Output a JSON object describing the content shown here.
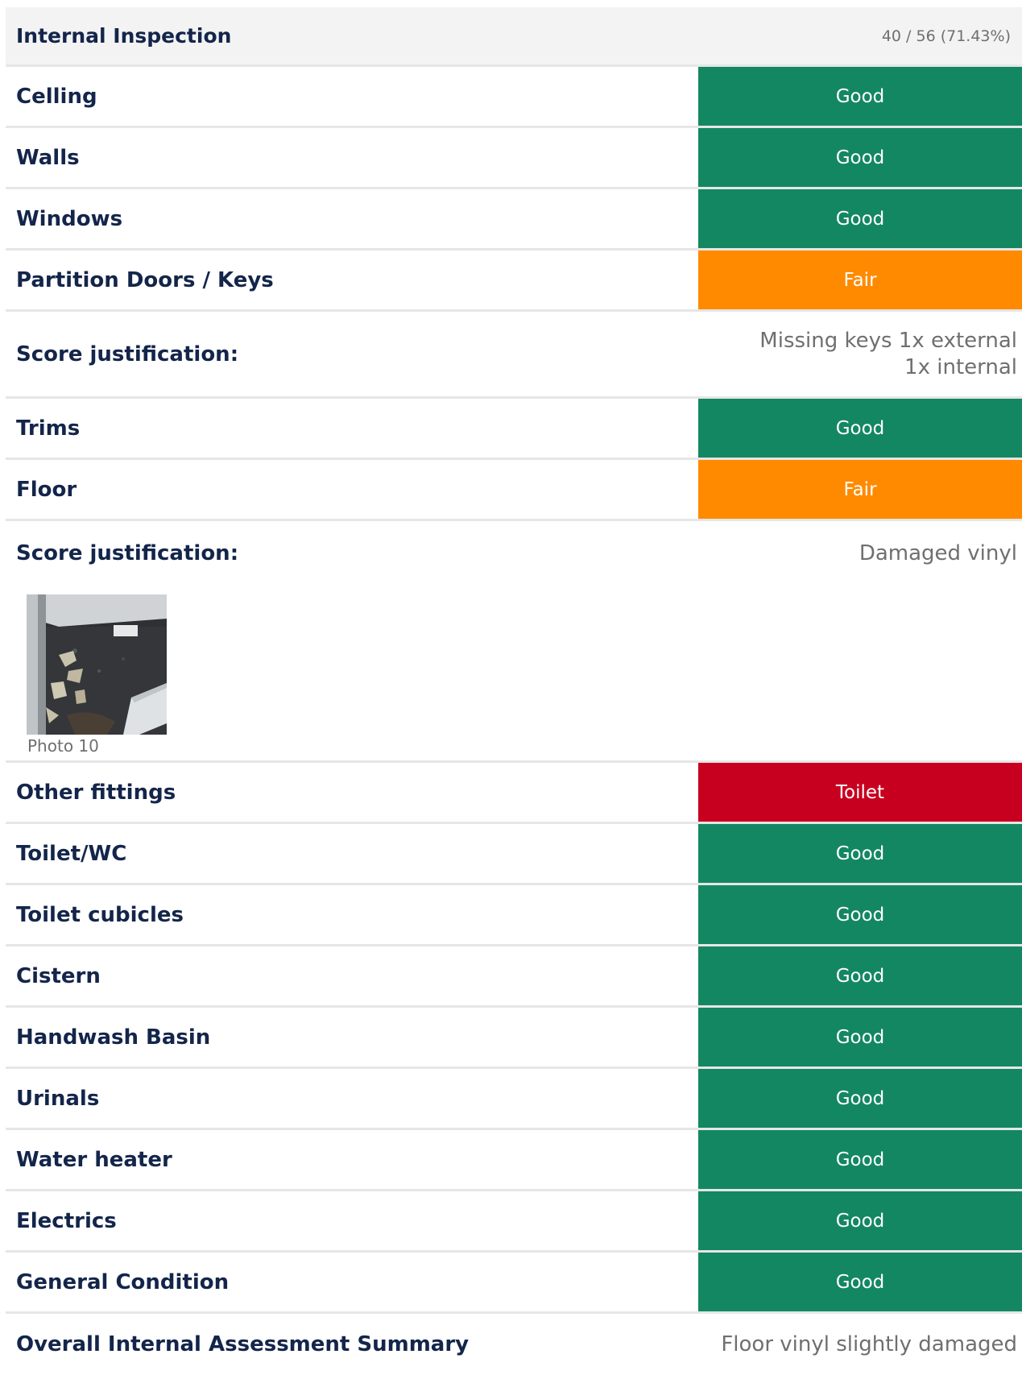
{
  "section": {
    "title": "Internal Inspection",
    "score": "40 / 56 (71.43%)"
  },
  "rows_a": [
    {
      "label": "Celling",
      "value": "Good",
      "status": "good"
    },
    {
      "label": "Walls",
      "value": "Good",
      "status": "good"
    },
    {
      "label": "Windows",
      "value": "Good",
      "status": "good"
    },
    {
      "label": "Partition Doors / Keys",
      "value": "Fair",
      "status": "fair"
    }
  ],
  "justification_1": {
    "label": "Score justification:",
    "value": "Missing keys 1x external 1x internal"
  },
  "rows_b": [
    {
      "label": "Trims",
      "value": "Good",
      "status": "good"
    },
    {
      "label": "Floor",
      "value": "Fair",
      "status": "fair"
    }
  ],
  "justification_2": {
    "label": "Score justification:",
    "value": "Damaged vinyl",
    "photo_caption": "Photo 10"
  },
  "rows_c": [
    {
      "label": "Other fittings",
      "value": "Toilet",
      "status": "poor"
    },
    {
      "label": "Toilet/WC",
      "value": "Good",
      "status": "good"
    },
    {
      "label": "Toilet cubicles",
      "value": "Good",
      "status": "good"
    },
    {
      "label": "Cistern",
      "value": "Good",
      "status": "good"
    },
    {
      "label": "Handwash Basin",
      "value": "Good",
      "status": "good"
    },
    {
      "label": "Urinals",
      "value": "Good",
      "status": "good"
    },
    {
      "label": "Water heater",
      "value": "Good",
      "status": "good"
    },
    {
      "label": "Electrics",
      "value": "Good",
      "status": "good"
    },
    {
      "label": "General Condition",
      "value": "Good",
      "status": "good"
    }
  ],
  "summary": {
    "label": "Overall Internal Assessment Summary",
    "value": "Floor vinyl slightly damaged"
  },
  "colors": {
    "good": "#138761",
    "fair": "#ff8a00",
    "poor": "#c8001f"
  }
}
